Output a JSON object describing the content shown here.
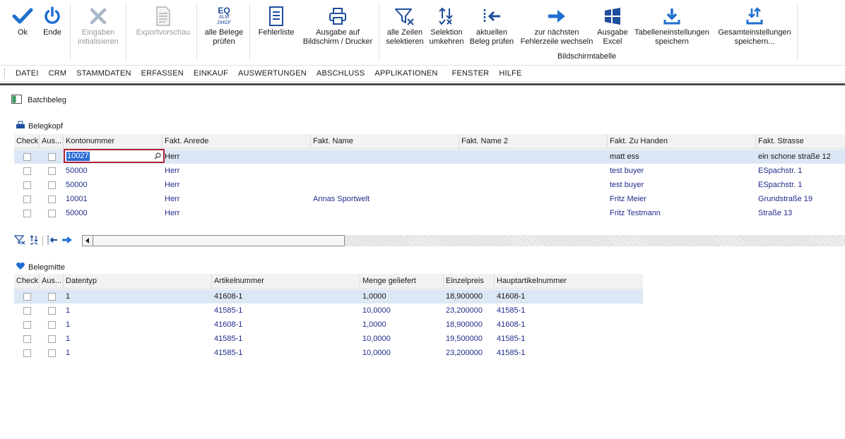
{
  "ribbon": {
    "ok": "Ok",
    "ende": "Ende",
    "eingaben_1": "Eingaben",
    "eingaben_2": "initialisieren",
    "exportvorschau": "Exportvorschau",
    "alle_belege_1": "alle Belege",
    "alle_belege_2": "prüfen",
    "fehlerliste": "Fehlerliste",
    "ausgabe_1": "Ausgabe auf",
    "ausgabe_2": "Bildschirm / Drucker",
    "alle_zeilen_1": "alle Zeilen",
    "alle_zeilen_2": "selektieren",
    "selektion_1": "Selektion",
    "selektion_2": "umkehren",
    "aktuellen_1": "aktuellen",
    "aktuellen_2": "Beleg prüfen",
    "naechste_1": "zur nächsten",
    "naechste_2": "Fehlerzeile wechseln",
    "excel_1": "Ausgabe",
    "excel_2": "Excel",
    "tab_1": "Tabelleneinstellungen",
    "tab_2": "speichern",
    "gesamt_1": "Gesamteinstellungen",
    "gesamt_2": "speichern...",
    "group_label": "Bildschirmtabelle",
    "icon_text_top": "EQ",
    "icon_text_mid": "ALM",
    "icon_text_bot": "JIHGF"
  },
  "menu": [
    "DATEI",
    "CRM",
    "STAMMDATEN",
    "ERFASSEN",
    "EINKAUF",
    "AUSWERTUNGEN",
    "ABSCHLUSS",
    "APPLIKATIONEN",
    "FENSTER",
    "HILFE"
  ],
  "window_title": "Batchbeleg",
  "belegkopf": {
    "title": "Belegkopf",
    "headers": [
      "Check",
      "Aus...",
      "Kontonummer",
      "Fakt. Anrede",
      "Fakt. Name",
      "Fakt. Name 2",
      "Fakt. Zu Handen",
      "Fakt. Strasse"
    ],
    "edit_value": "10027",
    "rows": [
      {
        "konto": "10027",
        "anrede": "Herr",
        "name": "",
        "name2": "",
        "handen": "matt ess",
        "strasse": "ein schone straße 12"
      },
      {
        "konto": "50000",
        "anrede": "Herr",
        "name": "",
        "name2": "",
        "handen": "test buyer",
        "strasse": "ESpachstr. 1"
      },
      {
        "konto": "50000",
        "anrede": "Herr",
        "name": "",
        "name2": "",
        "handen": "test buyer",
        "strasse": "ESpachstr. 1"
      },
      {
        "konto": "10001",
        "anrede": "Herr",
        "name": "Annas Sportwelt",
        "name2": "",
        "handen": "Fritz Meier",
        "strasse": "Grundstraße 19"
      },
      {
        "konto": "50000",
        "anrede": "Herr",
        "name": "",
        "name2": "",
        "handen": "Fritz Testmann",
        "strasse": "Straße 13"
      }
    ]
  },
  "belegmitte": {
    "title": "Belegmitte",
    "headers": [
      "Check",
      "Aus...",
      "Datentyp",
      "Artikelnummer",
      "Menge geliefert",
      "Einzelpreis",
      "Hauptartikelnummer"
    ],
    "rows": [
      {
        "datentyp": "1",
        "artikel": "41608-1",
        "menge": "1,0000",
        "preis": "18,900000",
        "haupt": "41608-1"
      },
      {
        "datentyp": "1",
        "artikel": "41585-1",
        "menge": "10,0000",
        "preis": "23,200000",
        "haupt": "41585-1"
      },
      {
        "datentyp": "1",
        "artikel": "41608-1",
        "menge": "1,0000",
        "preis": "18,900000",
        "haupt": "41608-1"
      },
      {
        "datentyp": "1",
        "artikel": "41585-1",
        "menge": "10,0000",
        "preis": "19,500000",
        "haupt": "41585-1"
      },
      {
        "datentyp": "1",
        "artikel": "41585-1",
        "menge": "10,0000",
        "preis": "23,200000",
        "haupt": "41585-1"
      }
    ]
  },
  "colors": {
    "accent": "#1f6fd1",
    "row_text": "#1f2c8a",
    "selection": "#dce7f5",
    "edit_border": "#b3213a"
  }
}
